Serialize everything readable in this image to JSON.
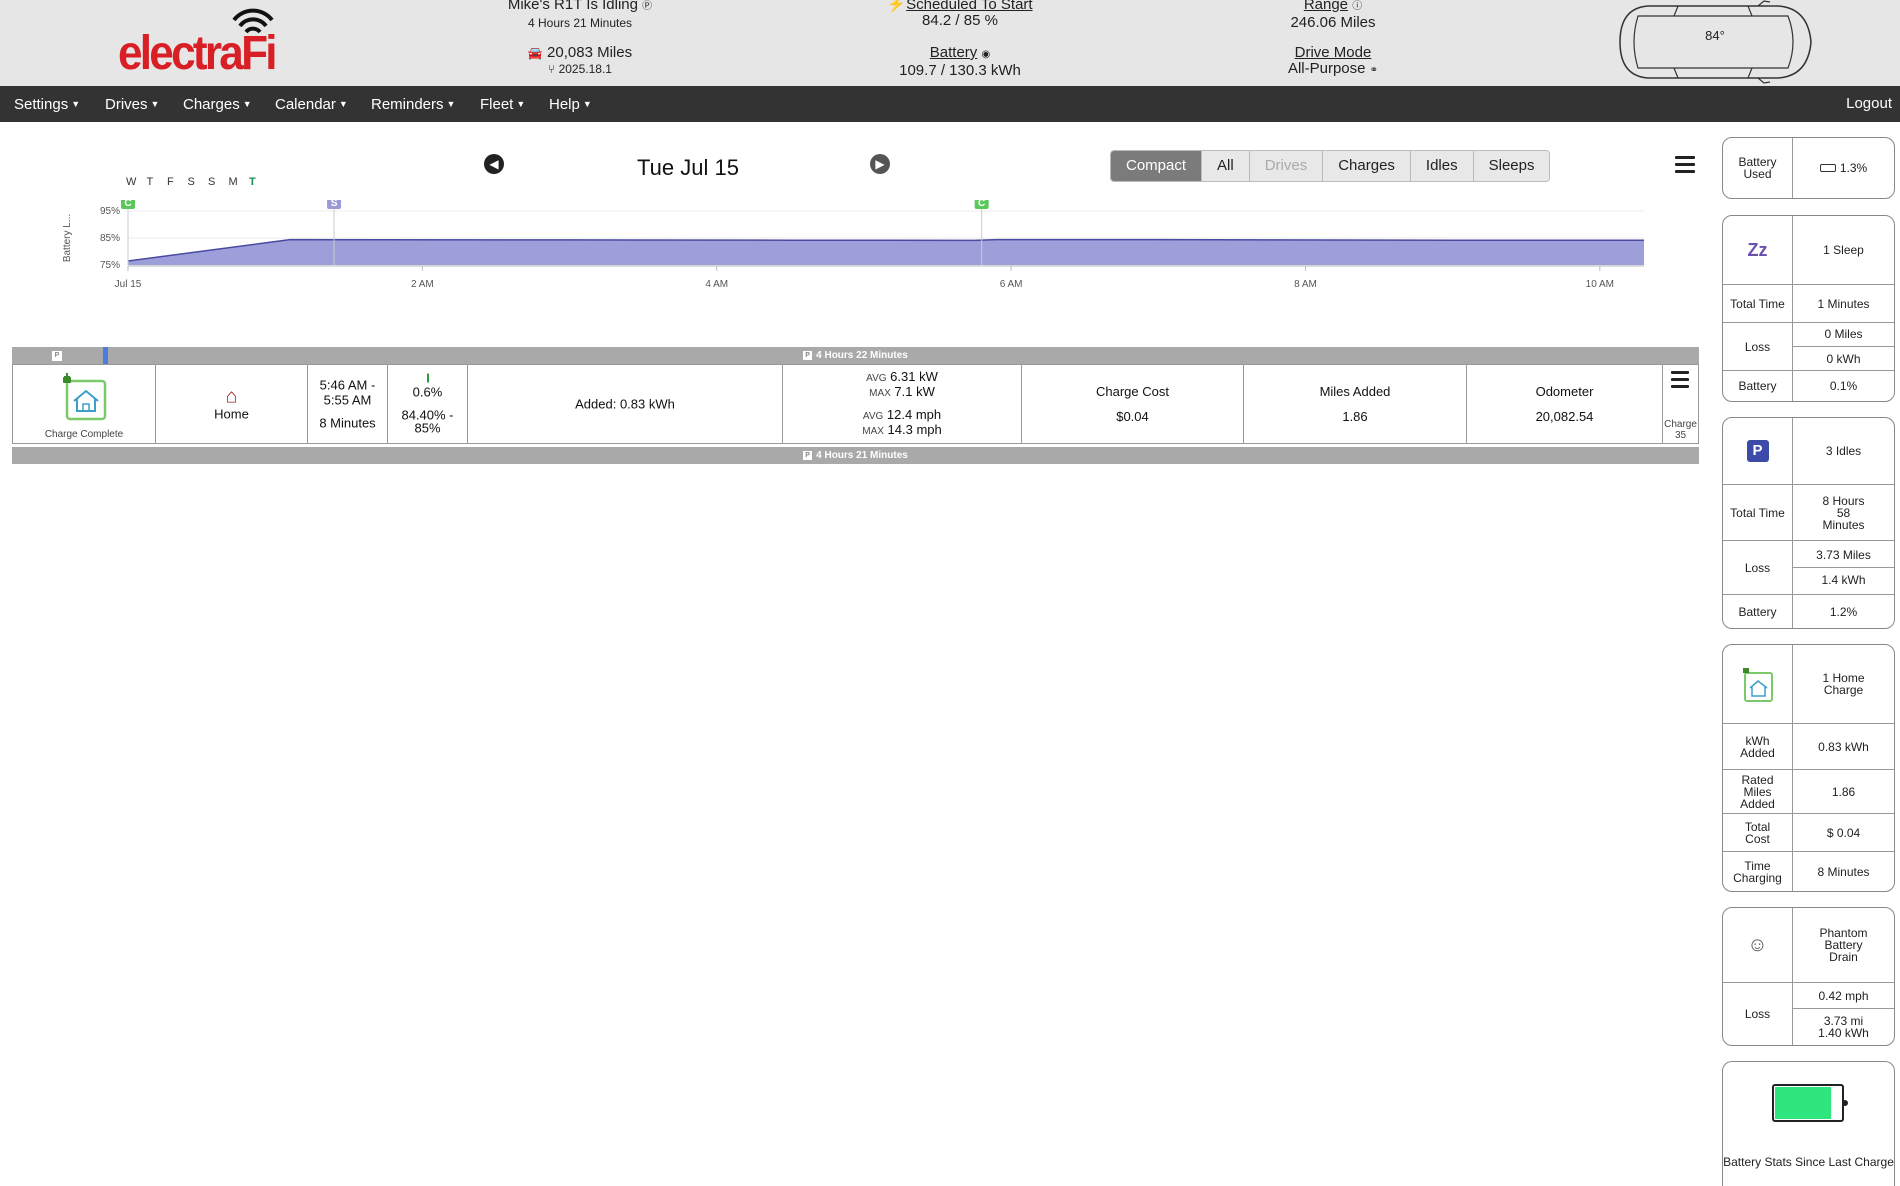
{
  "header": {
    "brand": "electraFi",
    "vehicle_status": "Mike's R1T Is Idling",
    "idle_duration": "4 Hours 21 Minutes",
    "odometer": "20,083 Miles",
    "software_version": "2025.18.1",
    "schedule_label": "Scheduled To Start",
    "schedule_value": "84.2 / 85 %",
    "battery_label": "Battery",
    "battery_value": "109.7 / 130.3 kWh",
    "range_label": "Range",
    "range_value": "246.06 Miles",
    "drive_mode_label": "Drive Mode",
    "drive_mode_value": "All-Purpose",
    "cabin_temp": "84°"
  },
  "nav": {
    "items": [
      "Settings",
      "Drives",
      "Charges",
      "Calendar",
      "Reminders",
      "Fleet",
      "Help"
    ],
    "logout": "Logout"
  },
  "day": {
    "weekdays": [
      "W",
      "T",
      "F",
      "S",
      "S",
      "M",
      "T"
    ],
    "date": "Tue Jul 15",
    "filters": [
      "Compact",
      "All",
      "Drives",
      "Charges",
      "Idles",
      "Sleeps"
    ],
    "active_filter": "Compact",
    "disabled_filter": "Drives"
  },
  "chart_data": {
    "type": "area",
    "ylabel": "Battery L...",
    "y_ticks": [
      "75%",
      "85%",
      "95%"
    ],
    "ylim": [
      75,
      95
    ],
    "x_ticks": [
      "Jul 15",
      "2 AM",
      "4 AM",
      "6 AM",
      "8 AM",
      "10 AM"
    ],
    "x_hours": [
      0,
      2,
      4,
      6,
      8,
      10
    ],
    "xlim": [
      0,
      10.3
    ],
    "series": [
      {
        "x": [
          0,
          1.1,
          3.0,
          4.5,
          5.75,
          5.9,
          7.0,
          9.0,
          10.3
        ],
        "values": [
          76.5,
          84.4,
          84.3,
          84.2,
          84.1,
          84.4,
          84.4,
          84.2,
          84.2
        ]
      }
    ],
    "markers": [
      {
        "label": "C",
        "x": 0.0,
        "color": "#5cc85c"
      },
      {
        "label": "S",
        "x": 1.4,
        "color": "#9a9ad6"
      },
      {
        "label": "C",
        "x": 5.8,
        "color": "#5cc85c"
      }
    ],
    "fill_color": "#9d9fdb",
    "line_color": "#4a4aa0"
  },
  "timeline": {
    "top_strip": "4 Hours 22 Minutes",
    "bottom_strip": "4 Hours 21 Minutes",
    "charge": {
      "status": "Charge Complete",
      "location": "Home",
      "time_range_start": "5:46 AM -",
      "time_range_end": "5:55 AM",
      "duration": "8 Minutes",
      "percent_added": "0.6%",
      "percent_range_start": "84.40% -",
      "percent_range_end": "85%",
      "added": "Added: 0.83 kWh",
      "avg_label": "AVG",
      "max_label": "MAX",
      "avg_power": "6.31 kW",
      "max_power": "7.1 kW",
      "avg_speed": "12.4 mph",
      "max_speed": "14.3 mph",
      "cost_label": "Charge Cost",
      "cost_value": "$0.04",
      "miles_label": "Miles Added",
      "miles_value": "1.86",
      "odo_label": "Odometer",
      "odo_value": "20,082.54",
      "menu_label_1": "Charge",
      "menu_label_2": "35"
    }
  },
  "sidebar": {
    "battery_used_label": "Battery Used",
    "battery_used_value": "1.3%",
    "sleep": {
      "title": "1 Sleep",
      "total_time_label": "Total Time",
      "total_time_value": "1 Minutes",
      "loss_label": "Loss",
      "loss_miles": "0 Miles",
      "loss_kwh": "0 kWh",
      "battery_label": "Battery",
      "battery_value": "0.1%"
    },
    "idles": {
      "title": "3 Idles",
      "total_time_label": "Total Time",
      "total_time_value": "8 Hours 58 Minutes",
      "loss_label": "Loss",
      "loss_miles": "3.73 Miles",
      "loss_kwh": "1.4 kWh",
      "battery_label": "Battery",
      "battery_value": "1.2%"
    },
    "home_charge": {
      "title": "1 Home Charge",
      "kwh_label": "kWh Added",
      "kwh_value": "0.83 kWh",
      "rated_label": "Rated Miles Added",
      "rated_value": "1.86",
      "cost_label": "Total Cost",
      "cost_value": "$ 0.04",
      "time_label": "Time Charging",
      "time_value": "8 Minutes"
    },
    "phantom": {
      "title": "Phantom Battery Drain",
      "loss_label": "Loss",
      "rate": "0.42 mph",
      "miles": "3.73 mi",
      "kwh": "1.40 kWh"
    },
    "battery_stats_label": "Battery Stats Since Last Charge",
    "battery_stats_level": 0.85
  }
}
